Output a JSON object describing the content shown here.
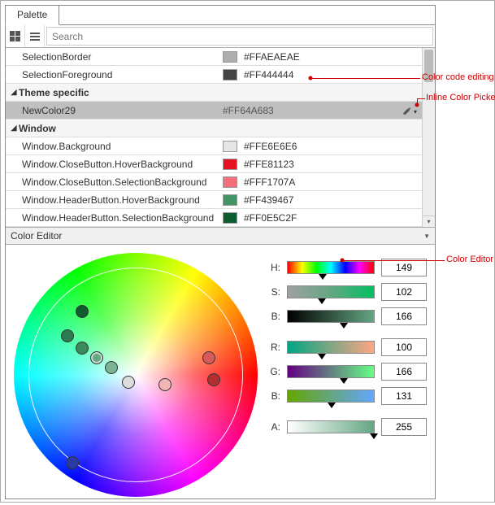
{
  "tab": {
    "title": "Palette"
  },
  "search": {
    "placeholder": "Search"
  },
  "rows": [
    {
      "name": "SelectionBorder",
      "value": "#FFAEAEAE",
      "swatch": "#AEAEAE"
    },
    {
      "name": "SelectionForeground",
      "value": "#FF444444",
      "swatch": "#444444"
    }
  ],
  "group_theme": {
    "label": "Theme specific"
  },
  "theme_rows": [
    {
      "name": "NewColor29",
      "value": "#FF64A683",
      "swatch": "#64A683",
      "selected": true
    }
  ],
  "group_window": {
    "label": "Window"
  },
  "window_rows": [
    {
      "name": "Window.Background",
      "value": "#FFE6E6E6",
      "swatch": "#E6E6E6"
    },
    {
      "name": "Window.CloseButton.HoverBackground",
      "value": "#FFE81123",
      "swatch": "#E81123"
    },
    {
      "name": "Window.CloseButton.SelectionBackground",
      "value": "#FFF1707A",
      "swatch": "#F1707A"
    },
    {
      "name": "Window.HeaderButton.HoverBackground",
      "value": "#FF439467",
      "swatch": "#439467"
    },
    {
      "name": "Window.HeaderButton.SelectionBackground",
      "value": "#FF0E5C2F",
      "swatch": "#0E5C2F"
    }
  ],
  "color_editor": {
    "title": "Color Editor"
  },
  "channels": {
    "H": {
      "value": "149",
      "marker": 41,
      "grad": "linear-gradient(to right, red, yellow, lime, cyan, blue, magenta, red)"
    },
    "S": {
      "value": "102",
      "marker": 40,
      "grad": "linear-gradient(to right, #888, #64A683, #00c060)"
    },
    "Bv": {
      "value": "166",
      "marker": 65,
      "grad": "linear-gradient(to right, #000, #64A683)"
    },
    "R": {
      "value": "100",
      "marker": 40,
      "grad": "linear-gradient(to right, #00A683, #64A683, #ffb290)"
    },
    "G": {
      "value": "166",
      "marker": 65,
      "grad": "linear-gradient(to right, #640083, #64A683, #64ff83)"
    },
    "Bc": {
      "value": "131",
      "marker": 51,
      "grad": "linear-gradient(to right, #64A600, #64A683, #64A6ff)"
    },
    "A": {
      "value": "255",
      "marker": 100,
      "grad": "linear-gradient(to right, #fff, #64A683)"
    }
  },
  "labels": {
    "H": "H:",
    "S": "S:",
    "Bv": "B:",
    "R": "R:",
    "G": "G:",
    "Bc": "B:",
    "A": "A:"
  },
  "annotations": {
    "code": "Color code editing",
    "picker": "Inline Color Picker",
    "editor": "Color Editor"
  },
  "chart_data": {
    "type": "colorpicker",
    "H": 149,
    "S": 102,
    "B": 166,
    "R": 100,
    "G": 166,
    "Bc": 131,
    "A": 255,
    "hex": "#FF64A683"
  }
}
